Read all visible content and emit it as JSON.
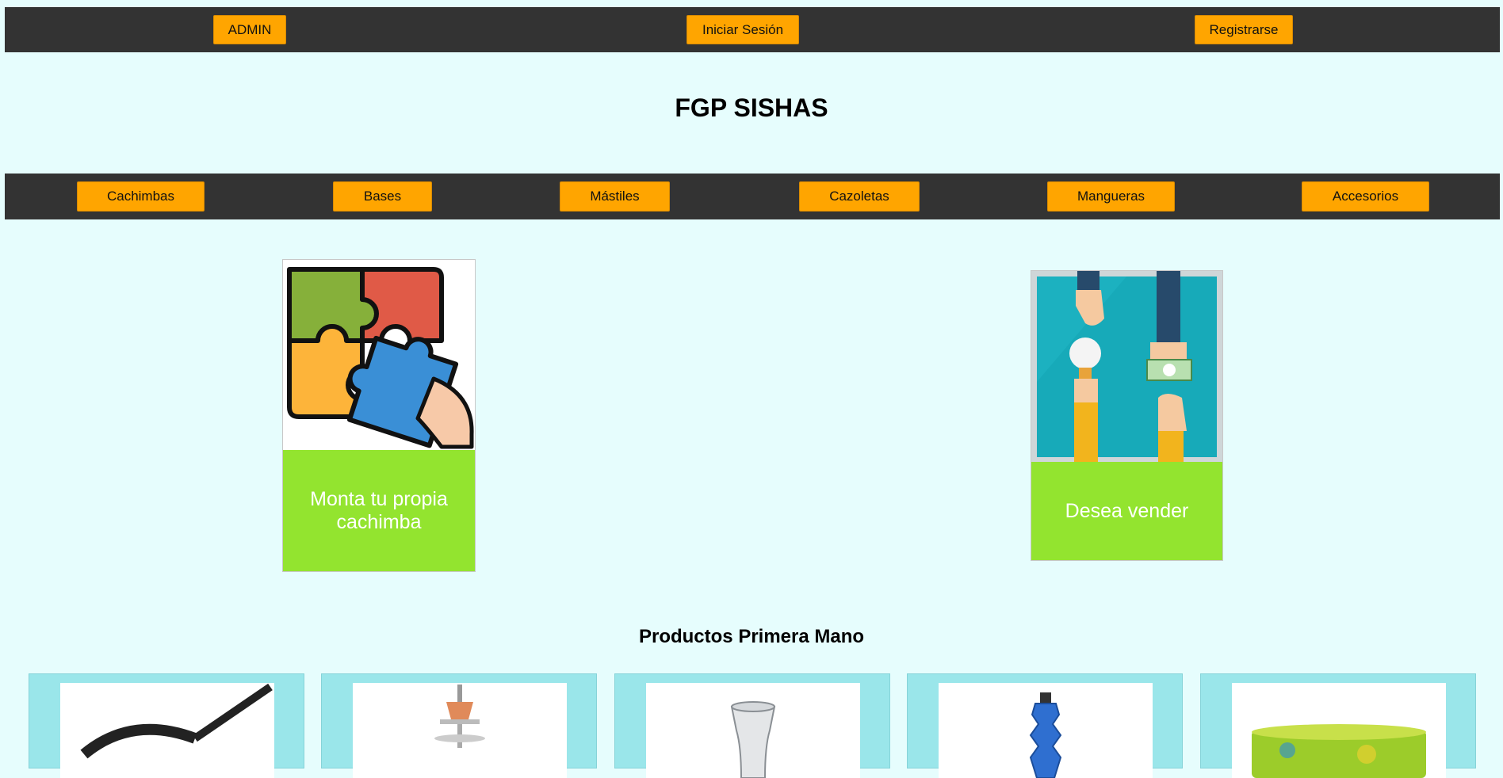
{
  "top_nav": {
    "admin": "ADMIN",
    "login": "Iniciar Sesión",
    "register": "Registrarse"
  },
  "site_title": "FGP SISHAS",
  "categories": [
    "Cachimbas",
    "Bases",
    "Mástiles",
    "Cazoletas",
    "Mangueras",
    "Accesorios"
  ],
  "promo_cards": {
    "build": {
      "label": "Monta tu propia cachimba",
      "icon": "puzzle-icon"
    },
    "sell": {
      "label": "Desea vender",
      "icon": "hands-exchange-icon"
    }
  },
  "section_title": "Productos Primera Mano",
  "products": [
    {
      "icon": "hose-icon"
    },
    {
      "icon": "hookah-top-icon"
    },
    {
      "icon": "glass-vase-icon"
    },
    {
      "icon": "blue-stem-icon"
    },
    {
      "icon": "green-bowl-icon"
    }
  ],
  "colors": {
    "accent": "#ffa500",
    "bar": "#333333",
    "background": "#e6fdfd",
    "card_label": "#93e42f",
    "product_bg": "#9ae6ea"
  }
}
